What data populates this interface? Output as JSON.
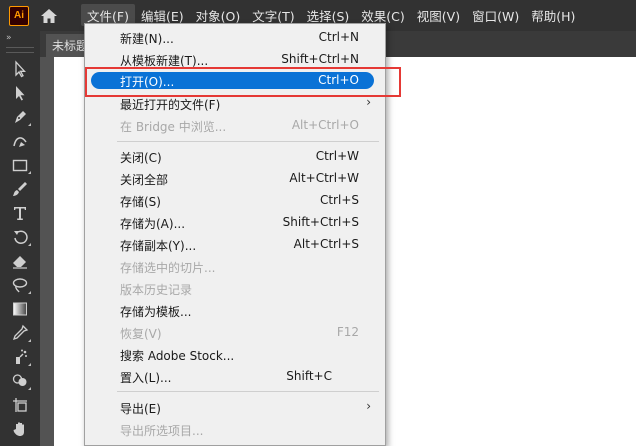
{
  "app": {
    "logo_text": "Ai"
  },
  "menubar": {
    "items": [
      "文件(F)",
      "编辑(E)",
      "对象(O)",
      "文字(T)",
      "选择(S)",
      "效果(C)",
      "视图(V)",
      "窗口(W)",
      "帮助(H)"
    ]
  },
  "toolbar": {
    "collapse": "»",
    "tools": [
      "selection",
      "direct-selection",
      "pen",
      "curvature",
      "rectangle",
      "paintbrush",
      "type",
      "rotate",
      "eraser",
      "lasso",
      "gradient",
      "eyedropper",
      "symbol-sprayer",
      "shape-builder",
      "artboard",
      "hand"
    ]
  },
  "document": {
    "tab_label": "未标题"
  },
  "file_menu": {
    "new": {
      "label": "新建(N)...",
      "shortcut": "Ctrl+N"
    },
    "new_from_template": {
      "label": "从模板新建(T)...",
      "shortcut": "Shift+Ctrl+N"
    },
    "open": {
      "label": "打开(O)...",
      "shortcut": "Ctrl+O"
    },
    "open_recent": {
      "label": "最近打开的文件(F)",
      "arrow": "›"
    },
    "browse_bridge": {
      "label": "在 Bridge 中浏览...",
      "shortcut": "Alt+Ctrl+O"
    },
    "close": {
      "label": "关闭(C)",
      "shortcut": "Ctrl+W"
    },
    "close_all": {
      "label": "关闭全部",
      "shortcut": "Alt+Ctrl+W"
    },
    "save": {
      "label": "存储(S)",
      "shortcut": "Ctrl+S"
    },
    "save_as": {
      "label": "存储为(A)...",
      "shortcut": "Shift+Ctrl+S"
    },
    "save_copy": {
      "label": "存储副本(Y)...",
      "shortcut": "Alt+Ctrl+S"
    },
    "save_selected_slices": {
      "label": "存储选中的切片..."
    },
    "version_history": {
      "label": "版本历史记录"
    },
    "save_as_template": {
      "label": "存储为模板..."
    },
    "revert": {
      "label": "恢复(V)",
      "shortcut": "F12"
    },
    "search_stock": {
      "label": "搜索 Adobe Stock..."
    },
    "place": {
      "label": "置入(L)...",
      "shortcut": "Shift+C"
    },
    "export": {
      "label": "导出(E)",
      "arrow": "›"
    },
    "export_selection": {
      "label": "导出所选项目..."
    }
  },
  "colors": {
    "highlight": "#0a72d6",
    "callout": "#e53935",
    "accent": "#ff9a00"
  }
}
